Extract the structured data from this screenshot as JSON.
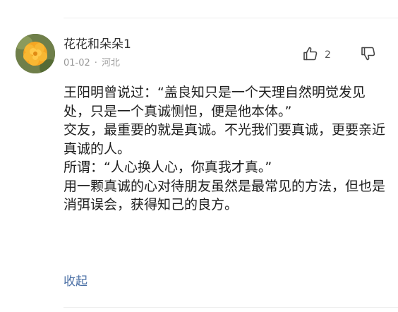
{
  "comment": {
    "username": "花花和朵朵1",
    "date": "01-02",
    "separator": "·",
    "location": "河北",
    "like_count": "2",
    "paragraphs": [
      "王阳明曾说过：“盖良知只是一个天理自然明觉发见处，只是一个真诚恻怛，便是他本体。”",
      "交友，最重要的就是真诚。不光我们要真诚，更要亲近真诚的人。",
      "所谓：“人心换人心，你真我才真。”",
      "用一颗真诚的心对待朋友虽然是最常见的方法，但也是消弭误会，获得知己的良方。"
    ],
    "collapse_label": "收起"
  },
  "icons": {
    "like": "thumbs-up-icon",
    "dislike": "thumbs-down-icon"
  },
  "colors": {
    "link": "#4a6fa5",
    "meta": "#999999"
  }
}
